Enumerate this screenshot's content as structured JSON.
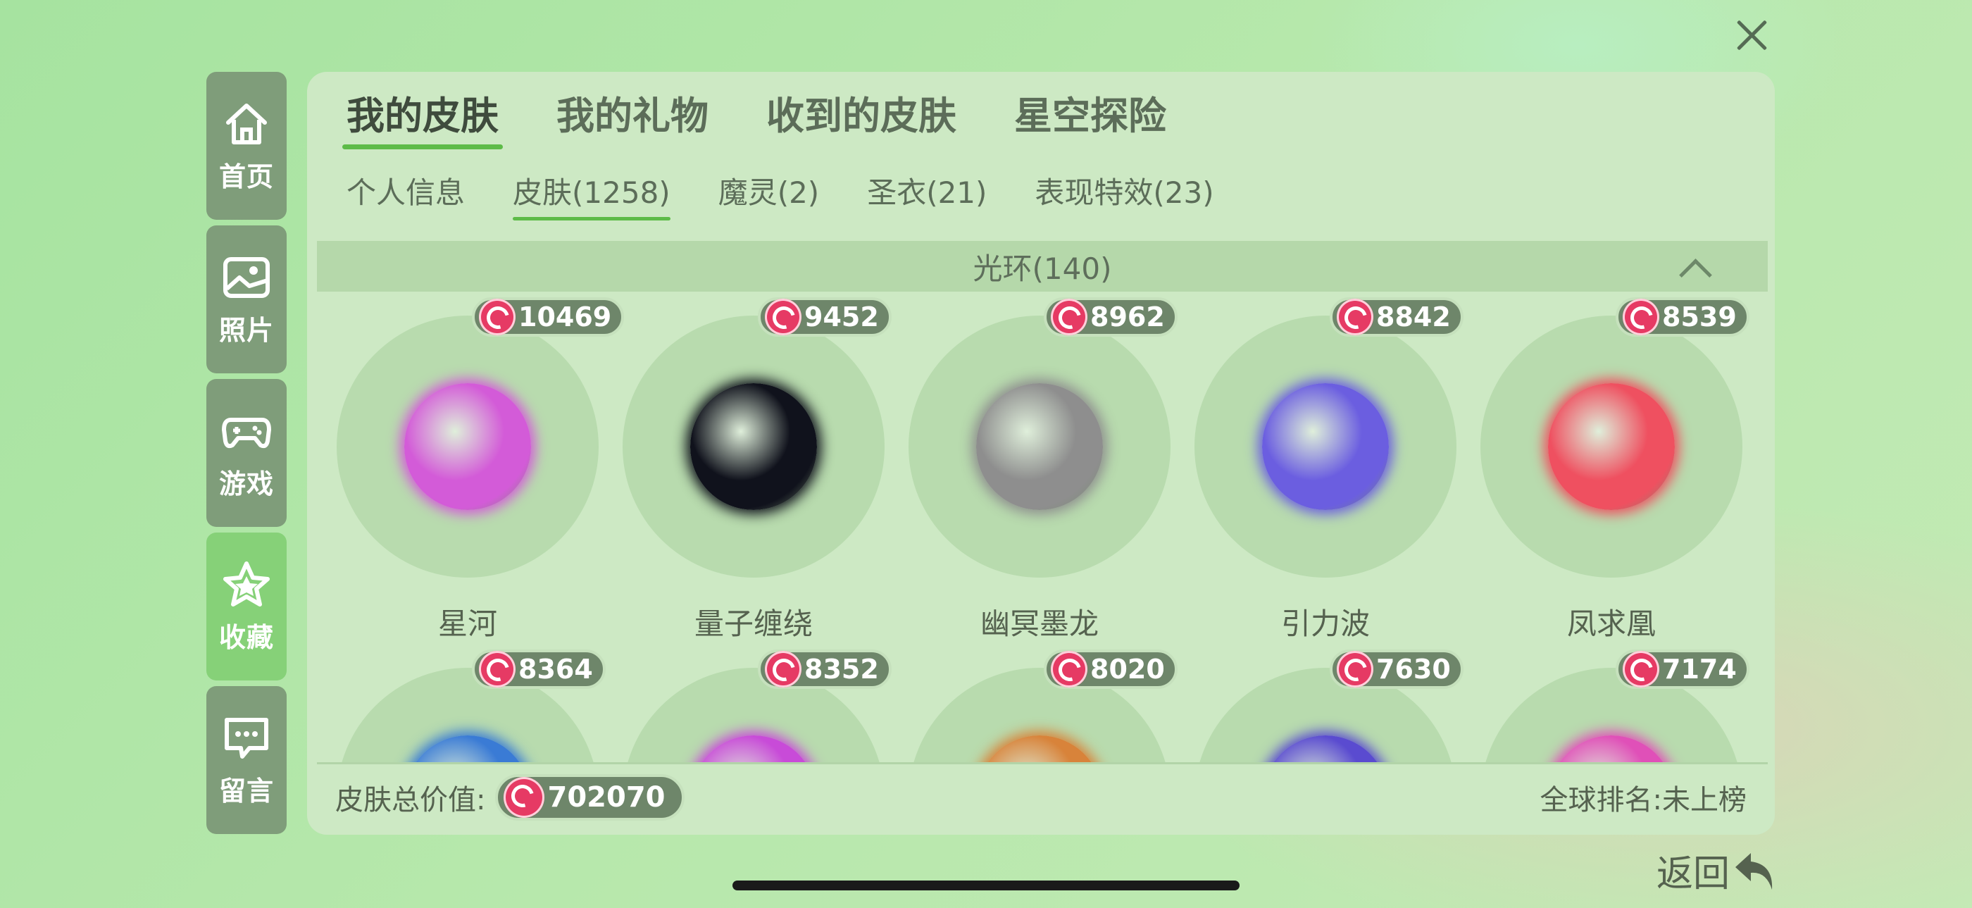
{
  "close_label": "×",
  "sidebar": [
    {
      "label": "首页",
      "icon": "home-icon",
      "active": false
    },
    {
      "label": "照片",
      "icon": "photo-icon",
      "active": false
    },
    {
      "label": "游戏",
      "icon": "gamepad-icon",
      "active": false
    },
    {
      "label": "收藏",
      "icon": "star-icon",
      "active": true
    },
    {
      "label": "留言",
      "icon": "message-icon",
      "active": false
    }
  ],
  "tabs": [
    "我的皮肤",
    "我的礼物",
    "收到的皮肤",
    "星空探险"
  ],
  "subtabs": [
    "个人信息",
    "皮肤(1258)",
    "魔灵(2)",
    "圣衣(21)",
    "表现特效(23)"
  ],
  "section": {
    "title": "光环(140)"
  },
  "items": [
    {
      "name": "星河",
      "price": "10469",
      "color": "#d35bd8"
    },
    {
      "name": "量子缠绕",
      "price": "9452",
      "color": "#10121c"
    },
    {
      "name": "幽冥墨龙",
      "price": "8962",
      "color": "#8e8e8e"
    },
    {
      "name": "引力波",
      "price": "8842",
      "color": "#6b5ee0"
    },
    {
      "name": "凤求凰",
      "price": "8539",
      "color": "#ef5060"
    },
    {
      "name": "",
      "price": "8364",
      "color": "#3a7bd5"
    },
    {
      "name": "",
      "price": "8352",
      "color": "#c84bd8"
    },
    {
      "name": "",
      "price": "8020",
      "color": "#d8833a"
    },
    {
      "name": "",
      "price": "7630",
      "color": "#5a4bd0"
    },
    {
      "name": "",
      "price": "7174",
      "color": "#e050b8"
    }
  ],
  "footer": {
    "total_label": "皮肤总价值:",
    "total_value": "702070",
    "rank": "全球排名:未上榜"
  },
  "back_label": "返回"
}
